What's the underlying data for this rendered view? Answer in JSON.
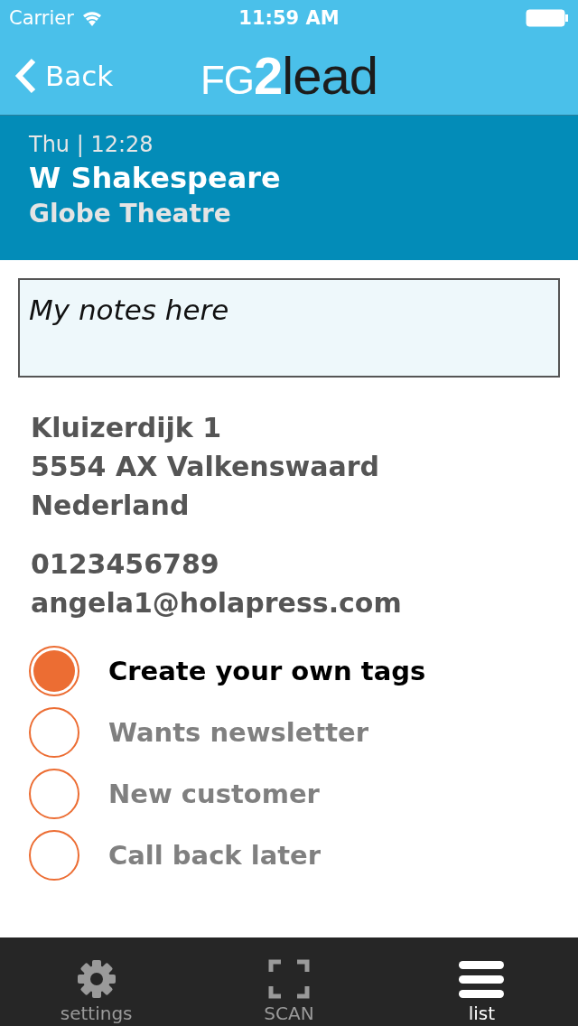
{
  "status_bar": {
    "carrier": "Carrier",
    "time": "11:59 AM"
  },
  "nav": {
    "back": "Back",
    "logo": [
      {
        "text": "FG",
        "kind": "thin"
      },
      {
        "text": "2",
        "kind": "bold"
      },
      {
        "text": "lead",
        "kind": "dark"
      }
    ]
  },
  "contact_header": {
    "datetime": "Thu | 12:28",
    "name": "W Shakespeare",
    "company": "Globe Theatre"
  },
  "notes": {
    "value": "My notes here"
  },
  "address": [
    "Kluizerdijk 1",
    "5554 AX Valkenswaard",
    "Nederland"
  ],
  "contact": {
    "phone": "0123456789",
    "email": "angela1@holapress.com"
  },
  "tags": [
    {
      "label": "Create your own tags",
      "checked": true
    },
    {
      "label": "Wants newsletter",
      "checked": false
    },
    {
      "label": "New customer",
      "checked": false
    },
    {
      "label": "Call back later",
      "checked": false
    }
  ],
  "tab_bar": [
    {
      "label": "settings",
      "kind": "gear",
      "selected": false
    },
    {
      "label": "SCAN",
      "kind": "scan",
      "selected": false
    },
    {
      "label": "list",
      "kind": "list",
      "selected": true
    }
  ]
}
